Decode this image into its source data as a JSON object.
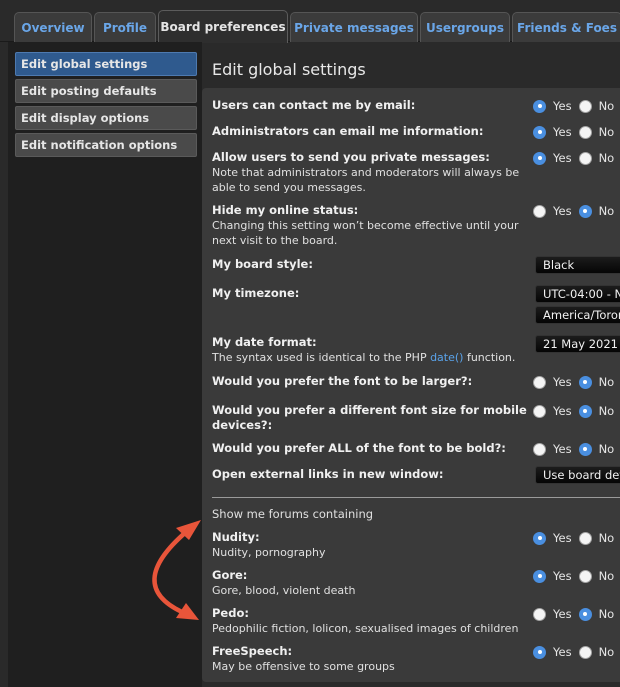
{
  "tabs": [
    "Overview",
    "Profile",
    "Board preferences",
    "Private messages",
    "Usergroups",
    "Friends & Foes"
  ],
  "nav": [
    "Edit global settings",
    "Edit posting defaults",
    "Edit display options",
    "Edit notification options"
  ],
  "page_title": "Edit global settings",
  "yes": "Yes",
  "no": "No",
  "settings": {
    "contact_email": {
      "label": "Users can contact me by email:",
      "value": "Yes"
    },
    "admin_email": {
      "label": "Administrators can email me information:",
      "value": "Yes"
    },
    "allow_pm": {
      "label": "Allow users to send you private messages:",
      "desc": "Note that administrators and moderators will always be able to send you messages.",
      "value": "Yes"
    },
    "hide_online": {
      "label": "Hide my online status:",
      "desc": "Changing this setting won’t become effective until your next visit to the board.",
      "value": "No"
    },
    "board_style": {
      "label": "My board style:",
      "value": "Black"
    },
    "timezone": {
      "label": "My timezone:",
      "value1": "UTC-04:00 - N",
      "value2": "America/Toron"
    },
    "date_format": {
      "label": "My date format:",
      "desc_pre": "The syntax used is identical to the PHP ",
      "desc_link": "date()",
      "desc_post": " function.",
      "value": "21 May 2021"
    },
    "font_larger": {
      "label": "Would you prefer the font to be larger?:",
      "value": "No"
    },
    "font_mobile": {
      "label": "Would you prefer a different font size for mobile devices?:",
      "value": "No"
    },
    "font_bold": {
      "label": "Would you prefer ALL of the font to be bold?:",
      "value": "No"
    },
    "ext_links": {
      "label": "Open external links in new window:",
      "value": "Use board def"
    }
  },
  "forums_heading": "Show me forums containing",
  "forums": {
    "nudity": {
      "label": "Nudity:",
      "desc": "Nudity, pornography",
      "value": "Yes"
    },
    "gore": {
      "label": "Gore:",
      "desc": "Gore, blood, violent death",
      "value": "Yes"
    },
    "pedo": {
      "label": "Pedo:",
      "desc": "Pedophilic fiction, lolicon, sexualised images of children",
      "value": "No"
    },
    "freespeech": {
      "label": "FreeSpeech:",
      "desc": "May be offensive to some groups",
      "value": "Yes"
    }
  },
  "colors": {
    "accent": "#4a8fe0",
    "arrow": "#e8553a",
    "active_nav": "#2f5a8e"
  }
}
